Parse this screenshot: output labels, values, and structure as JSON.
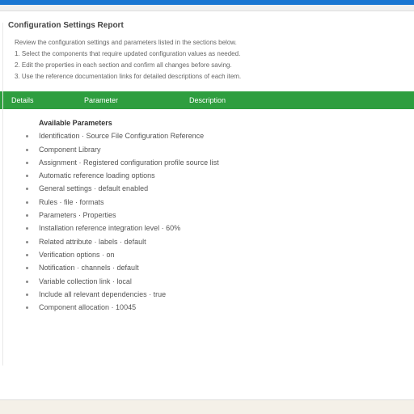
{
  "window": {
    "title": ""
  },
  "page": {
    "title": "Configuration Settings Report",
    "intro": [
      "Review the configuration settings and parameters listed in the sections below.",
      "1. Select the components that require updated configuration values as needed.",
      "2. Edit the properties in each section and confirm all changes before saving.",
      "3. Use the reference documentation links for detailed descriptions of each item."
    ]
  },
  "toolbar": {
    "col1": "Details",
    "col2": "Parameter",
    "col3": "Description"
  },
  "list": {
    "header": "Available Parameters",
    "items": [
      "Identification · Source File Configuration Reference",
      "Component Library",
      "Assignment · Registered configuration profile source list",
      "Automatic reference loading options",
      "General settings · default enabled",
      "Rules · file · formats",
      "Parameters · Properties",
      "Installation reference integration level · 60%",
      "Related attribute · labels · default",
      "Verification options · on",
      "Notification · channels · default",
      "Variable collection link · local",
      "Include all relevant dependencies · true",
      "Component allocation · 10045"
    ]
  }
}
